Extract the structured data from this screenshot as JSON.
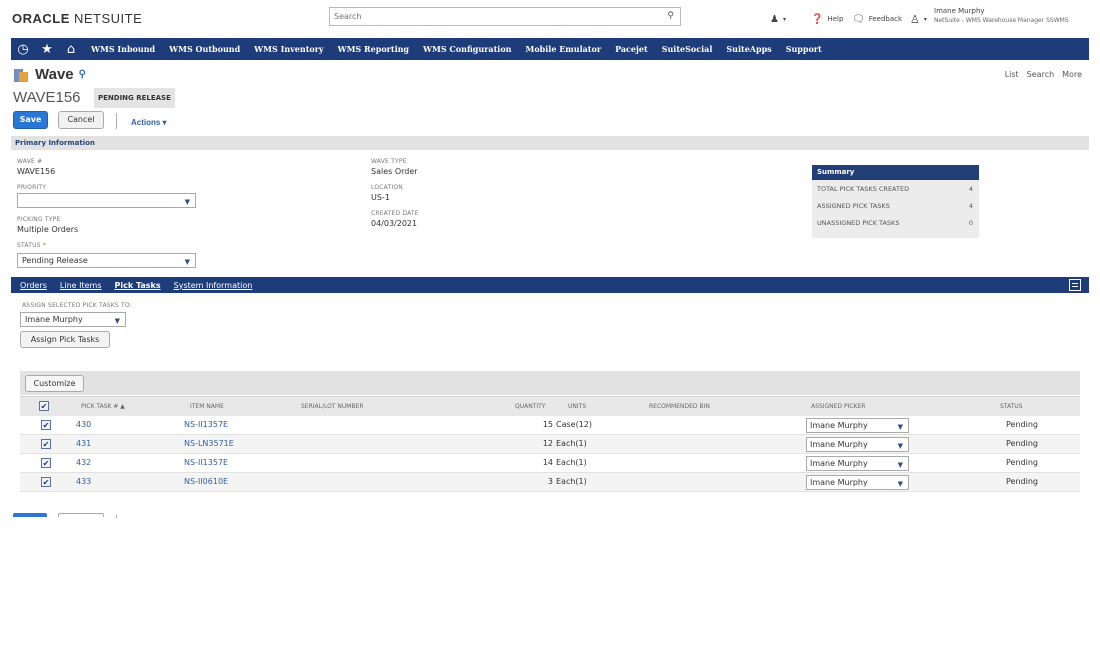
{
  "header": {
    "logo_strong": "ORACLE",
    "logo_rest": " NETSUITE",
    "search_placeholder": "Search",
    "help": "Help",
    "feedback": "Feedback",
    "user_name": "Imane Murphy",
    "user_role": "NetSuite - WMS Warehouse Manager SSWMS"
  },
  "nav": {
    "items": [
      "WMS Inbound",
      "WMS Outbound",
      "WMS Inventory",
      "WMS Reporting",
      "WMS Configuration",
      "Mobile Emulator",
      "Pacejet",
      "SuiteSocial",
      "SuiteApps",
      "Support"
    ]
  },
  "page": {
    "title": "Wave",
    "record_id": "WAVE156",
    "status_badge": "PENDING RELEASE",
    "links": {
      "list": "List",
      "search": "Search",
      "more": "More"
    }
  },
  "toolbar": {
    "save": "Save",
    "cancel": "Cancel",
    "actions": "Actions ▾"
  },
  "primary": {
    "section_title": "Primary Information",
    "wave_label": "WAVE #",
    "wave_value": "WAVE156",
    "priority_label": "PRIORITY",
    "priority_value": "",
    "picking_type_label": "PICKING TYPE",
    "picking_type_value": "Multiple Orders",
    "status_label": "STATUS",
    "status_value": "Pending Release",
    "wave_type_label": "WAVE TYPE",
    "wave_type_value": "Sales Order",
    "location_label": "LOCATION",
    "location_value": "US-1",
    "created_label": "CREATED DATE",
    "created_value": "04/03/2021"
  },
  "summary": {
    "title": "Summary",
    "rows": [
      {
        "label": "TOTAL PICK TASKS CREATED",
        "value": "4"
      },
      {
        "label": "ASSIGNED PICK TASKS",
        "value": "4"
      },
      {
        "label": "UNASSIGNED PICK TASKS",
        "value": "0"
      }
    ]
  },
  "subtabs": {
    "orders": "Orders",
    "line_items": "Line Items",
    "pick_tasks": "Pick Tasks",
    "system_info": "System Information"
  },
  "assign": {
    "label": "ASSIGN SELECTED PICK TASKS TO:",
    "value": "Imane Murphy",
    "button": "Assign Pick Tasks"
  },
  "grid": {
    "customize": "Customize",
    "columns": {
      "task": "PICK TASK # ▲",
      "item": "ITEM NAME",
      "serial": "SERIAL/LOT NUMBER",
      "qty": "QUANTITY",
      "units": "UNITS",
      "bin": "RECOMMENDED BIN",
      "picker": "ASSIGNED PICKER",
      "status": "STATUS"
    },
    "rows": [
      {
        "task": "430",
        "item": "NS-II1357E",
        "qty": "15",
        "units": "Case(12)",
        "picker": "Imane Murphy",
        "status": "Pending"
      },
      {
        "task": "431",
        "item": "NS-LN3571E",
        "qty": "12",
        "units": "Each(1)",
        "picker": "Imane Murphy",
        "status": "Pending"
      },
      {
        "task": "432",
        "item": "NS-II1357E",
        "qty": "14",
        "units": "Each(1)",
        "picker": "Imane Murphy",
        "status": "Pending"
      },
      {
        "task": "433",
        "item": "NS-II0610E",
        "qty": "3",
        "units": "Each(1)",
        "picker": "Imane Murphy",
        "status": "Pending"
      }
    ]
  }
}
